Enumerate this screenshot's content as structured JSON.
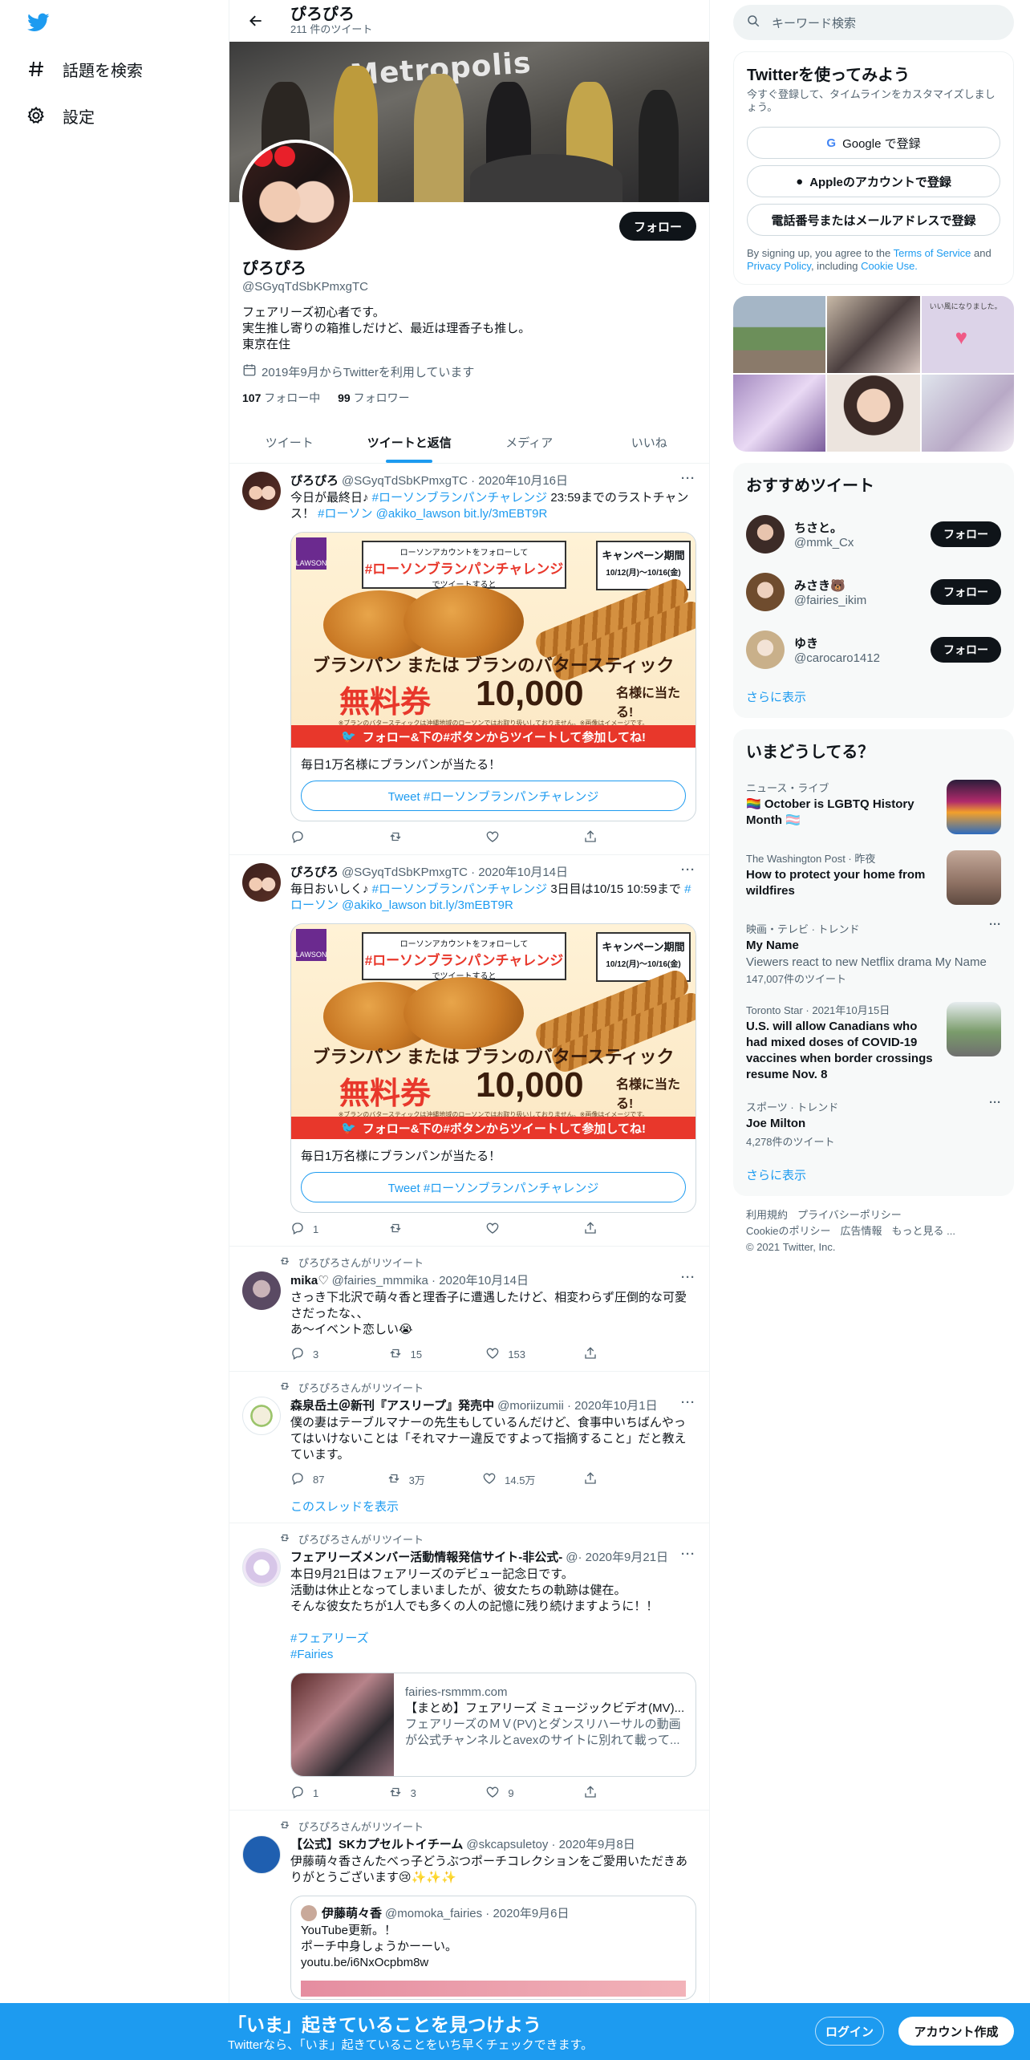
{
  "nav": {
    "explore": "話題を検索",
    "settings": "設定"
  },
  "header": {
    "name": "ぴろぴろ",
    "tweet_count": "211 件のツイート"
  },
  "banner": {
    "text": "Metropolis"
  },
  "profile": {
    "name": "ぴろぴろ",
    "handle": "@SGyqTdSbKPmxgTC",
    "follow_label": "フォロー",
    "bio": [
      "フェアリーズ初心者です。",
      "実生推し寄りの箱推しだけど、最近は理香子も推し。",
      "東京在住"
    ],
    "joined": "2019年9月からTwitterを利用しています",
    "following_count": "107",
    "following_label": " フォロー中",
    "followers_count": "99",
    "followers_label": " フォロワー"
  },
  "tabs": [
    "ツイート",
    "ツイートと返信",
    "メディア",
    "いいね"
  ],
  "promo": {
    "top_small": "ローソンアカウントをフォローして",
    "top_big": "#ローソンブランパンチャレンジ",
    "top_small2": "でツイートすると",
    "period_title": "キャンペーン期間",
    "period_dates": "10/12(月)～10/16(金)",
    "slogan": "ブランパン または ブランのバタースティック",
    "free": "無料券",
    "number": "10,000",
    "suffix": "名様に当たる!",
    "fine_print": "※ブランのバタースティックは沖縄地域のローソンではお取り扱いしておりません。※画像はイメージです。",
    "redbar": "フォロー&下の#ボタンからツイートして参加してね!",
    "lawson": "LAWSON"
  },
  "tweets": [
    {
      "name": "ぴろぴろ",
      "handle": "@SGyqTdSbKPmxgTC · 2020年10月16日",
      "text1": "今日が最終日♪ ",
      "hashtag1": "#ローソンブランパンチャレンジ",
      "text2": " 23:59までのラストチャンス！ ",
      "links": "#ローソン @akiko_lawson bit.ly/3mEBT9R",
      "card_text": "毎日1万名様にブランパンが当たる！",
      "card_btn": "Tweet #ローソンブランパンチャレンジ",
      "reply": "",
      "retweet": "",
      "like": ""
    },
    {
      "name": "ぴろぴろ",
      "handle": "@SGyqTdSbKPmxgTC · 2020年10月14日",
      "text1": "毎日おいしく♪ ",
      "hashtag1": "#ローソンブランパンチャレンジ",
      "text2": " 3日目は10/15 10:59まで ",
      "links": "#ローソン @akiko_lawson bit.ly/3mEBT9R",
      "card_text": "毎日1万名様にブランパンが当たる！",
      "card_btn": "Tweet #ローソンブランパンチャレンジ",
      "reply": "1",
      "retweet": "",
      "like": ""
    },
    {
      "rt_label": "ぴろぴろさんがリツイート",
      "name": "mika♡",
      "handle": "@fairies_mmmika · 2020年10月14日",
      "text": [
        "さっき下北沢で萌々香と理香子に遭遇したけど、相変わらず圧倒的な可愛さだったな、、",
        "あ〜イベント恋しい😭"
      ],
      "reply": "3",
      "retweet": "15",
      "like": "153"
    },
    {
      "rt_label": "ぴろぴろさんがリツイート",
      "name": "森泉岳土＠新刊『アスリープ』発売中",
      "handle": "@moriizumii · 2020年10月1日",
      "text": [
        "僕の妻はテーブルマナーの先生もしているんだけど、食事中いちばんやってはいけないことは「それマナー違反ですよって指摘すること」だと教えています。"
      ],
      "reply": "87",
      "retweet": "3万",
      "like": "14.5万",
      "show_thread": "このスレッドを表示"
    },
    {
      "rt_label": "ぴろぴろさんがリツイート",
      "name": "フェアリーズメンバー活動情報発信サイト-非公式-",
      "handle": "@· 2020年9月21日",
      "text": [
        "本日9月21日はフェアリーズのデビュー記念日です。",
        "活動は休止となってしまいましたが、彼女たちの軌跡は健在。",
        "そんな彼女たちが1人でも多くの人の記憶に残り続けますように！！"
      ],
      "hashtags": [
        "#フェアリーズ",
        "#Fairies"
      ],
      "link_domain": "fairies-rsmmm.com",
      "link_title": "【まとめ】フェアリーズ ミュージックビデオ(MV)...",
      "link_desc": "フェアリーズのＭＶ(PV)とダンスリハーサルの動画が公式チャンネルとavexのサイトに別れて載って...",
      "reply": "1",
      "retweet": "3",
      "like": "9"
    },
    {
      "rt_label": "ぴろぴろさんがリツイート",
      "name": "【公式】SKカプセルトイチーム",
      "handle": "@skcapsuletoy · 2020年9月8日",
      "text": [
        "伊藤萌々香さんたべっ子どうぶつポーチコレクションをご愛用いただきありがとうございます😢✨✨✨"
      ],
      "quote_name": "伊藤萌々香",
      "quote_handle": "@momoka_fairies · 2020年9月6日",
      "quote_text": [
        "YouTube更新。！",
        "ポーチ中身しょうかーーい。",
        "youtu.be/i6NxOcpbm8w"
      ]
    }
  ],
  "right": {
    "search_placeholder": "キーワード検索",
    "signup_title": "Twitterを使ってみよう",
    "signup_sub": "今すぐ登録して、タイムラインをカスタマイズしましょう。",
    "google": "Google で登録",
    "apple": "Appleのアカウントで登録",
    "phone": "電話番号またはメールアドレスで登録",
    "legal_1": "By signing up, you agree to the ",
    "legal_terms": "Terms of Service",
    "legal_and": " and ",
    "legal_privacy": "Privacy Policy",
    "legal_incl": ", including ",
    "legal_cookie": "Cookie Use.",
    "media_caption": "いい風になりました。",
    "who_title": "おすすめツイート",
    "who": [
      {
        "name": "ちさと。",
        "handle": "@mmk_Cx",
        "btn": "フォロー"
      },
      {
        "name": "みさき🐻",
        "handle": "@fairies_ikim",
        "btn": "フォロー"
      },
      {
        "name": "ゆき",
        "handle": "@carocaro1412",
        "btn": "フォロー"
      }
    ],
    "show_more": "さらに表示",
    "trends_title": "いまどうしてる？",
    "trends": [
      {
        "ctx": "ニュース・ライブ",
        "title": "🏳️‍🌈 October is LGBTQ History Month 🏳️‍⚧️"
      },
      {
        "ctx": "The Washington Post · 昨夜",
        "title": "How to protect your home from wildfires"
      },
      {
        "ctx": "映画・テレビ · トレンド",
        "title": "My Name",
        "sub": "Viewers react to new Netflix drama My Name",
        "count": "147,007件のツイート"
      },
      {
        "ctx": "Toronto Star · 2021年10月15日",
        "title": "U.S. will allow Canadians who had mixed doses of COVID-19 vaccines when border crossings resume Nov. 8"
      },
      {
        "ctx": "スポーツ · トレンド",
        "title": "Joe Milton",
        "count": "4,278件のツイート"
      }
    ],
    "trends_more": "さらに表示",
    "footer": [
      "利用規約",
      "プライバシーポリシー",
      "Cookieのポリシー",
      "広告情報",
      "もっと見る ...",
      "© 2021 Twitter, Inc."
    ]
  },
  "bottom": {
    "title": "「いま」起きていることを見つけよう",
    "sub": "Twitterなら、「いま」起きていることをいち早くチェックできます。",
    "login": "ログイン",
    "signup": "アカウント作成"
  },
  "colors": {
    "accent": "#1d9bf0",
    "text": "#0f1419",
    "secondary": "#536471"
  }
}
